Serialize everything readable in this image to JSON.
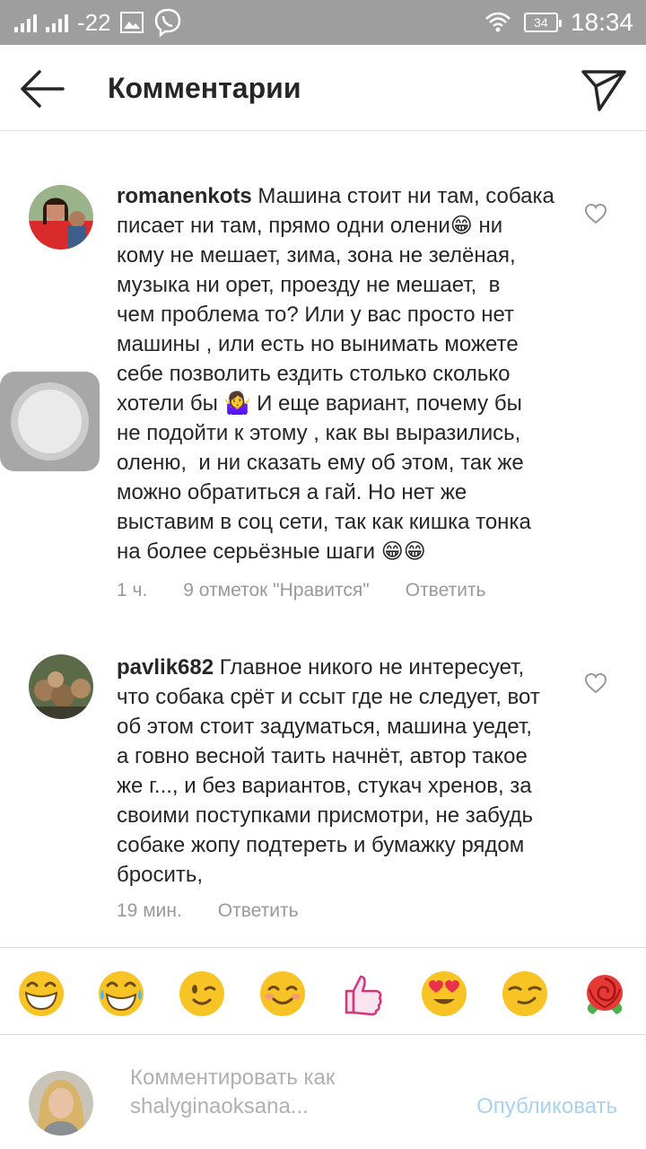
{
  "status_bar": {
    "temperature": "-22",
    "battery": "34",
    "time": "18:34"
  },
  "header": {
    "title": "Комментарии"
  },
  "comments": [
    {
      "username": "romanenkots",
      "text": " Машина стоит ни там, собака\nписает ни там, прямо одни олени😁 ни\nкому не мешает, зима, зона не зелёная,\nмузыка ни орет, проезду не мешает,  в\nчем проблема то? Или у вас просто нет\nмашины , или есть но вынимать можете\nсебе позволить ездить столько сколько\nхотели бы 🤷‍♀ И еще вариант, почему бы\nне подойти к этому , как вы выразились,\nоленю,  и ни сказать ему об этом, так же\nможно обратиться а гай. Но нет же\nвыставим в соц сети, так как кишка тонка\nна более серьёзные шаги 😁😁",
      "time": "1 ч.",
      "likes": "9 отметок \"Нравится\"",
      "reply": "Ответить"
    },
    {
      "username": "pavlik682",
      "text": " Главное никого не интересует,\nчто собака срёт и ссыт где не следует, вот\nоб этом стоит задуматься, машина уедет,\nа говно весной таить начнёт, автор такое\nже г..., и без вариантов, стукач хренов, за\nсвоими поступками присмотри, не забудь\nсобаке жопу подтереть и бумажку рядом\nбросить,",
      "time": "19 мин.",
      "reply": "Ответить"
    }
  ],
  "emoji_bar": [
    "grinning-face",
    "tears-of-joy-face",
    "winking-face",
    "smiling-face",
    "thumbs-up",
    "heart-eyes-face",
    "smirking-face",
    "rose"
  ],
  "composer": {
    "placeholder": "Комментировать как shalyginaoksana...",
    "publish": "Опубликовать"
  },
  "colors": {
    "status_bar": "#9e9e9e",
    "publish_disabled": "#a9d1f0",
    "meta_text": "#999999"
  }
}
